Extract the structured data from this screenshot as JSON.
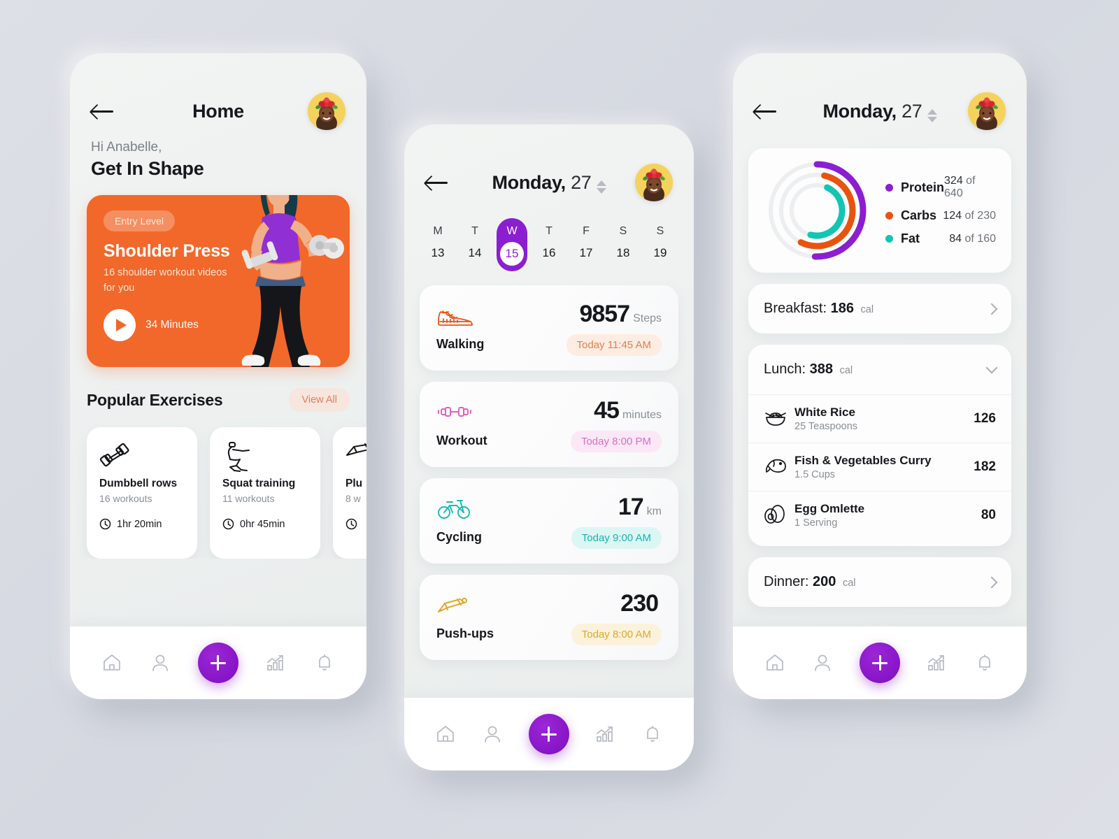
{
  "colors": {
    "purple": "#8c1ed1",
    "orange": "#e8540f",
    "teal": "#14c4b4",
    "promo_orange": "#f2682a",
    "background": "#d6d9e0"
  },
  "phone1": {
    "header": {
      "title": "Home",
      "back_icon": "back-arrow-icon",
      "avatar_icon": "user-avatar"
    },
    "greeting": {
      "hi": "Hi Anabelle,",
      "headline": "Get In Shape"
    },
    "promo": {
      "badge": "Entry Level",
      "title": "Shoulder Press",
      "subtitle": "16 shoulder workout videos for you",
      "duration": "34 Minutes",
      "play_icon": "play-icon"
    },
    "section": {
      "title": "Popular Exercises",
      "view_all": "View All"
    },
    "exercises": [
      {
        "icon": "dumbbell-icon",
        "name": "Dumbbell rows",
        "workouts": "16 workouts",
        "duration": "1hr 20min"
      },
      {
        "icon": "squat-icon",
        "name": "Squat training",
        "workouts": "11 workouts",
        "duration": "0hr 45min"
      },
      {
        "icon": "plank-icon",
        "name": "Plu",
        "workouts": "8 w",
        "duration": ""
      }
    ],
    "nav": [
      {
        "icon": "home-icon",
        "label": "Home"
      },
      {
        "icon": "profile-icon",
        "label": "Profile"
      },
      {
        "icon": "plus-icon",
        "label": "Add"
      },
      {
        "icon": "stats-icon",
        "label": "Stats"
      },
      {
        "icon": "bell-icon",
        "label": "Notifications"
      }
    ]
  },
  "phone2": {
    "header": {
      "title_bold": "Monday,",
      "title_light": " 27",
      "back_icon": "back-arrow-icon",
      "stepper_icon": "stepper-icon",
      "avatar_icon": "user-avatar"
    },
    "week": [
      {
        "letter": "M",
        "num": "13",
        "active": false
      },
      {
        "letter": "T",
        "num": "14",
        "active": false
      },
      {
        "letter": "W",
        "num": "15",
        "active": true
      },
      {
        "letter": "T",
        "num": "16",
        "active": false
      },
      {
        "letter": "F",
        "num": "17",
        "active": false
      },
      {
        "letter": "S",
        "num": "18",
        "active": false
      },
      {
        "letter": "S",
        "num": "19",
        "active": false
      }
    ],
    "activities": [
      {
        "icon": "shoe-icon",
        "name": "Walking",
        "value": "9857",
        "unit": "Steps",
        "time": "Today 11:45 AM",
        "color": "#e8540f",
        "bg": "#fcece2"
      },
      {
        "icon": "dumbbell-icon",
        "name": "Workout",
        "value": "45",
        "unit": "minutes",
        "time": "Today 8:00 PM",
        "color": "#e060c0",
        "bg": "#fbe8f6"
      },
      {
        "icon": "bicycle-icon",
        "name": "Cycling",
        "value": "17",
        "unit": "km",
        "time": "Today 9:00 AM",
        "color": "#13bdb0",
        "bg": "#dcf6f4"
      },
      {
        "icon": "pushup-icon",
        "name": "Push-ups",
        "value": "230",
        "unit": "",
        "time": "Today 8:00 AM",
        "color": "#e0a92a",
        "bg": "#fbf2db"
      }
    ],
    "nav": [
      {
        "icon": "home-icon",
        "label": "Home"
      },
      {
        "icon": "profile-icon",
        "label": "Profile"
      },
      {
        "icon": "plus-icon",
        "label": "Add"
      },
      {
        "icon": "stats-icon",
        "label": "Stats"
      },
      {
        "icon": "bell-icon",
        "label": "Notifications"
      }
    ]
  },
  "phone3": {
    "header": {
      "title_bold": "Monday,",
      "title_light": " 27",
      "back_icon": "back-arrow-icon",
      "stepper_icon": "stepper-icon",
      "avatar_icon": "user-avatar"
    },
    "macros": [
      {
        "label": "Protein",
        "value": "324",
        "of": "of 640",
        "color": "#8c1ed1",
        "current": 324,
        "target": 640
      },
      {
        "label": "Carbs",
        "value": "124",
        "of": "of 230",
        "color": "#e8540f",
        "current": 124,
        "target": 230
      },
      {
        "label": "Fat",
        "value": "84",
        "of": "of 160",
        "color": "#14c4b4",
        "current": 84,
        "target": 160
      }
    ],
    "meals": [
      {
        "name": "Breakfast:",
        "calories": "186",
        "cal_unit": "cal",
        "expanded": false,
        "chevron": "chevron-right-icon",
        "items": []
      },
      {
        "name": "Lunch:",
        "calories": "388",
        "cal_unit": "cal",
        "expanded": true,
        "chevron": "chevron-down-icon",
        "items": [
          {
            "icon": "rice-bowl-icon",
            "name": "White Rice",
            "serving": "25 Teaspoons",
            "calories": "126"
          },
          {
            "icon": "fish-icon",
            "name": "Fish & Vegetables Curry",
            "serving": "1.5 Cups",
            "calories": "182"
          },
          {
            "icon": "egg-icon",
            "name": "Egg Omlette",
            "serving": "1 Serving",
            "calories": "80"
          }
        ]
      },
      {
        "name": "Dinner:",
        "calories": "200",
        "cal_unit": "cal",
        "expanded": false,
        "chevron": "chevron-right-icon",
        "items": []
      }
    ],
    "nav": [
      {
        "icon": "home-icon",
        "label": "Home"
      },
      {
        "icon": "profile-icon",
        "label": "Profile"
      },
      {
        "icon": "plus-icon",
        "label": "Add"
      },
      {
        "icon": "stats-icon",
        "label": "Stats"
      },
      {
        "icon": "bell-icon",
        "label": "Notifications"
      }
    ]
  },
  "chart_data": {
    "type": "pie",
    "title": "Macronutrient progress rings",
    "categories": [
      "Protein",
      "Carbs",
      "Fat"
    ],
    "values": [
      324,
      124,
      84
    ],
    "targets": [
      640,
      230,
      160
    ],
    "percent": [
      50.6,
      53.9,
      52.5
    ],
    "colors": [
      "#8c1ed1",
      "#e8540f",
      "#14c4b4"
    ],
    "legend": [
      "Protein 324 of 640",
      "Carbs 124 of 230",
      "Fat 84 of 160"
    ],
    "legend_position": "right",
    "grid": false
  }
}
